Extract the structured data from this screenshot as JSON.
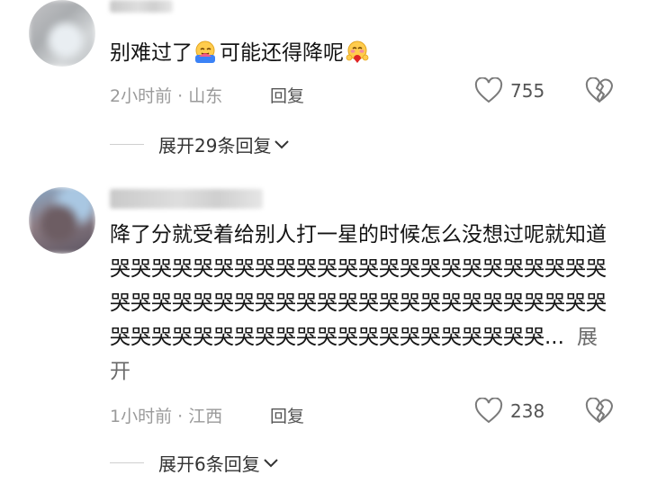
{
  "comments": [
    {
      "text_before_emoji": "别难过了",
      "text_middle": "可能还得降呢",
      "emoji1": "hugging-face-emoji",
      "emoji2": "hugging-face-emoji",
      "time": "2小时前",
      "location": "山东",
      "reply_label": "回复",
      "likes": "755",
      "expand_replies": "展开29条回复"
    },
    {
      "text": "降了分就受着给别人打一星的时候怎么没想过呢就知道哭哭哭哭哭哭哭哭哭哭哭哭哭哭哭哭哭哭哭哭哭哭哭哭哭哭哭哭哭哭哭哭哭哭哭哭哭哭哭哭哭哭哭哭哭哭哭哭哭哭哭哭哭哭哭哭哭哭哭哭哭哭哭哭哭哭哭哭哭...",
      "expand_inline": "展开",
      "time": "1小时前",
      "location": "江西",
      "reply_label": "回复",
      "likes": "238",
      "expand_replies": "展开6条回复"
    }
  ],
  "separator_dot": "·",
  "icons": {
    "like": "heart-outline-icon",
    "dislike": "broken-heart-icon",
    "expand": "chevron-down-icon"
  }
}
